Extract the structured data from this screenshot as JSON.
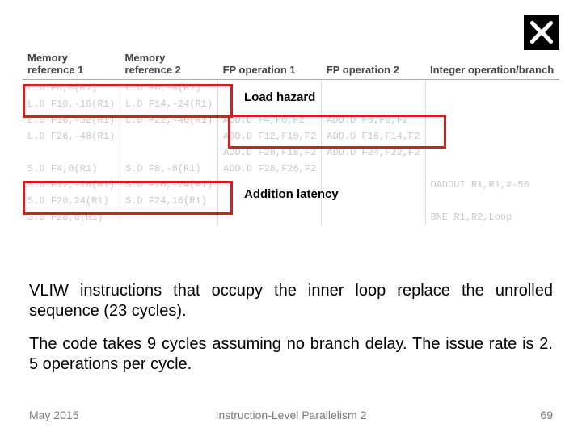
{
  "logo_name": "aleph-logo",
  "headers": {
    "m1": "Memory reference 1",
    "m2": "Memory reference 2",
    "f1": "FP operation 1",
    "f2": "FP operation 2",
    "ib": "Integer operation/branch"
  },
  "rows": [
    {
      "m1": "L.D F0,0(R1)",
      "m2": "L.D F6,-8(R1)",
      "f1": "",
      "f2": "",
      "i": ""
    },
    {
      "m1": "L.D F10,-16(R1)",
      "m2": "L.D F14,-24(R1)",
      "f1": "",
      "f2": "",
      "i": ""
    },
    {
      "m1": "L.D F18,-32(R1)",
      "m2": "L.D F22,-40(R1)",
      "f1": "ADD.D F4,F0,F2",
      "f2": "ADD.D F8,F6,F2",
      "i": ""
    },
    {
      "m1": "L.D F26,-48(R1)",
      "m2": "",
      "f1": "ADD.D F12,F10,F2",
      "f2": "ADD.D F16,F14,F2",
      "i": ""
    },
    {
      "m1": "",
      "m2": "",
      "f1": "ADD.D F20,F18,F2",
      "f2": "ADD.D F24,F22,F2",
      "i": ""
    },
    {
      "m1": "S.D F4,0(R1)",
      "m2": "S.D F8,-8(R1)",
      "f1": "ADD.D F28,F26,F2",
      "f2": "",
      "i": ""
    },
    {
      "m1": "S.D F12,-16(R1)",
      "m2": "S.D F16,-24(R1)",
      "f1": "",
      "f2": "",
      "i": "DADDUI R1,R1,#-56"
    },
    {
      "m1": "S.D F20,24(R1)",
      "m2": "S.D F24,16(R1)",
      "f1": "",
      "f2": "",
      "i": ""
    },
    {
      "m1": "S.D F28,8(R1)",
      "m2": "",
      "f1": "",
      "f2": "",
      "i": "BNE R1,R2,Loop"
    }
  ],
  "labels": {
    "load_hazard": "Load hazard",
    "addition_latency": "Addition latency"
  },
  "paragraphs": {
    "p1": "VLIW instructions that occupy the inner loop replace the unrolled sequence (23 cycles).",
    "p2": "The code takes 9 cycles assuming no branch delay. The issue rate is 2. 5 operations per cycle."
  },
  "footer": {
    "date": "May 2015",
    "title": "Instruction-Level Parallelism 2",
    "page": "69"
  }
}
